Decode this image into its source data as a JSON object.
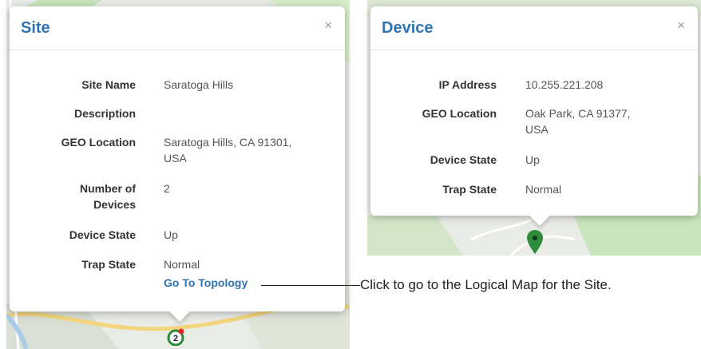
{
  "site_popup": {
    "title": "Site",
    "close_glyph": "×",
    "fields": [
      {
        "label": "Site Name",
        "value": "Saratoga Hills"
      },
      {
        "label": "Description",
        "value": ""
      },
      {
        "label": "GEO Location",
        "value": "Saratoga Hills, CA 91301, USA"
      },
      {
        "label": "Number of Devices",
        "value": "2"
      },
      {
        "label": "Device State",
        "value": "Up"
      },
      {
        "label": "Trap State",
        "value": "Normal"
      }
    ],
    "link_label": "Go To Topology"
  },
  "device_popup": {
    "title": "Device",
    "close_glyph": "×",
    "fields": [
      {
        "label": "IP Address",
        "value": "10.255.221.208"
      },
      {
        "label": "GEO Location",
        "value": "Oak Park, CA 91377, USA"
      },
      {
        "label": "Device State",
        "value": "Up"
      },
      {
        "label": "Trap State",
        "value": "Normal"
      }
    ]
  },
  "callout": {
    "text": "Click to go to the Logical Map for the Site."
  },
  "site_marker": {
    "count": "2",
    "icon": "site-cluster-marker",
    "ring_color": "#2e8b3a",
    "alert_color": "#d9262b"
  },
  "device_marker": {
    "icon": "map-pin-icon",
    "color": "#2e8b3a"
  },
  "colors": {
    "accent": "#2e74b5",
    "map_base": "#e9ebe6",
    "map_green": "#c8e5bd",
    "map_road": "#f2d57d"
  }
}
